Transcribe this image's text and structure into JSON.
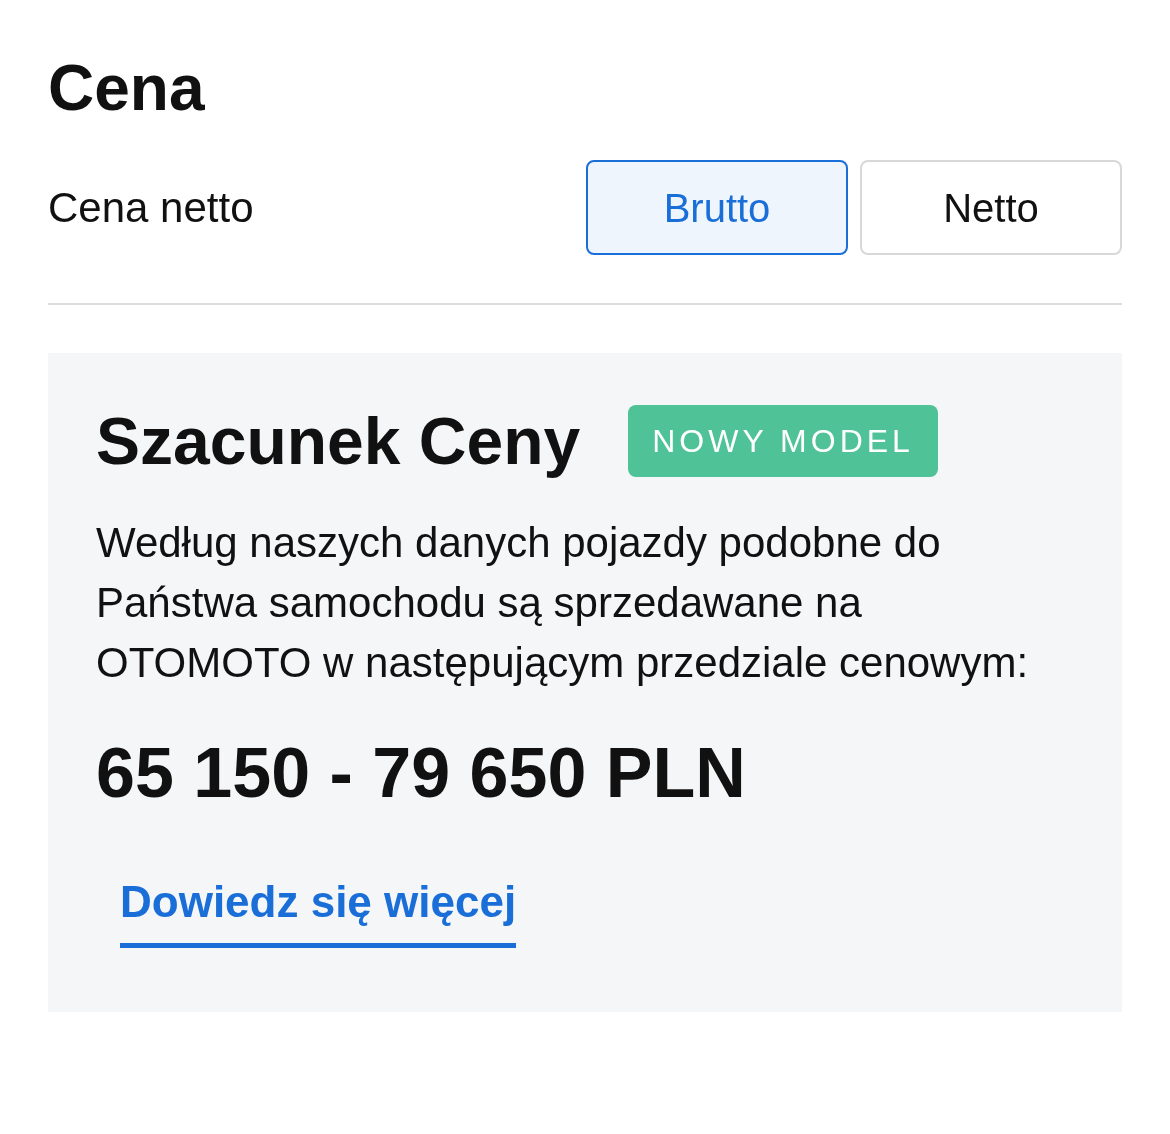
{
  "title": "Cena",
  "price_type": {
    "label": "Cena netto",
    "options": [
      {
        "label": "Brutto",
        "selected": true
      },
      {
        "label": "Netto",
        "selected": false
      }
    ]
  },
  "estimate": {
    "title": "Szacunek Ceny",
    "badge": "NOWY MODEL",
    "description": "Według naszych danych pojazdy podobne do Państwa samochodu są sprzedawane na OTOMOTO w następującym przedziale cenowym:",
    "price_range": "65 150 - 79 650 PLN",
    "link": "Dowiedz się więcej"
  }
}
